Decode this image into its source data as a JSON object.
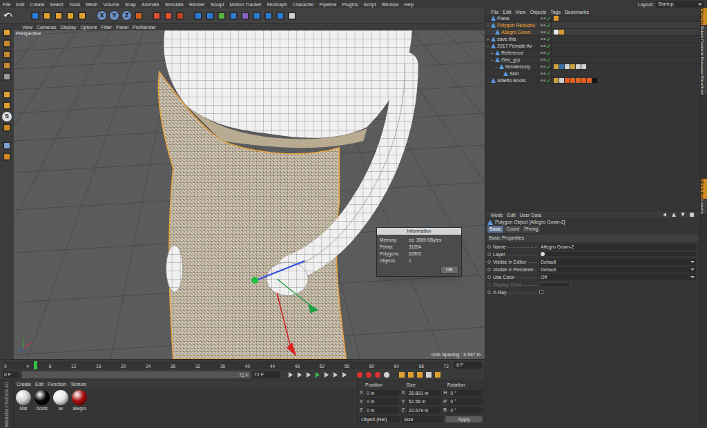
{
  "menu_bar": {
    "items": [
      "File",
      "Edit",
      "Create",
      "Select",
      "Tools",
      "Mesh",
      "Volume",
      "Snap",
      "Animate",
      "Simulate",
      "Render",
      "Sculpt",
      "Motion Tracker",
      "MoGraph",
      "Character",
      "Pipeline",
      "Plugins",
      "Script",
      "Window",
      "Help"
    ],
    "layout_label": "Layout:",
    "layout_value": "Startup"
  },
  "toolbar": {
    "axis_buttons": [
      {
        "label": "X",
        "on": true
      },
      {
        "label": "Y",
        "on": true
      },
      {
        "label": "Z",
        "on": true
      }
    ]
  },
  "left_tools": {
    "snap_label": "S"
  },
  "viewport": {
    "menu": [
      "View",
      "Cameras",
      "Display",
      "Options",
      "Filter",
      "Panel",
      "ProRender"
    ],
    "camera": "Perspective",
    "grid_spacing": "Grid Spacing : 3.937 in"
  },
  "info_dialog": {
    "title": "Information",
    "rows": [
      {
        "label": "Memory:",
        "value": "ca. 3889 KBytes"
      },
      {
        "label": "Points:",
        "value": "31654"
      },
      {
        "label": "Polygons:",
        "value": "62892"
      },
      {
        "label": "Objects:",
        "value": "1"
      }
    ],
    "button": "OK"
  },
  "timeline": {
    "ticks": [
      "0",
      "4",
      "8",
      "12",
      "16",
      "20",
      "24",
      "28",
      "32",
      "36",
      "40",
      "44",
      "48",
      "52",
      "56",
      "60",
      "64",
      "68",
      "72"
    ],
    "level": 0.07,
    "frame_field": "6 F"
  },
  "transport": {
    "start": "0 F",
    "range_end": "72 F",
    "end": "72 F"
  },
  "materials": {
    "menu": [
      "Create",
      "Edit",
      "Function",
      "Texture"
    ],
    "items": [
      {
        "name": "Mat",
        "color": "#cfcfcf"
      },
      {
        "name": "boots",
        "color": "#050505"
      },
      {
        "name": "av",
        "color": "#e6e6e6"
      },
      {
        "name": "allegro",
        "color": "#a80d0d"
      }
    ]
  },
  "coordinates": {
    "headers": [
      "Position",
      "Size",
      "Rotation"
    ],
    "rows": [
      {
        "p_axis": "X",
        "p": "0 in",
        "s_axis": "X",
        "s": "28.891 in",
        "r_axis": "H",
        "r": "0 °"
      },
      {
        "p_axis": "Y",
        "p": "0 in",
        "s_axis": "Y",
        "s": "52.56 in",
        "r_axis": "P",
        "r": "0 °"
      },
      {
        "p_axis": "Z",
        "p": "0 in",
        "s_axis": "Z",
        "s": "22.679 in",
        "r_axis": "B",
        "r": "0 °"
      }
    ],
    "mode": "Object (Rel)",
    "size_mode": "Size",
    "apply": "Apply"
  },
  "object_manager": {
    "menu": [
      "File",
      "Edit",
      "View",
      "Objects",
      "Tags",
      "Bookmarks"
    ],
    "objects": [
      {
        "name": "Plane",
        "depth": 0,
        "expandable": false,
        "expanded": false,
        "selected": false,
        "enabled": true,
        "tags": [
          "#d99a2b"
        ]
      },
      {
        "name": "Polygon Reductio",
        "depth": 0,
        "expandable": true,
        "expanded": true,
        "selected": true,
        "enabled": true,
        "tags": []
      },
      {
        "name": "Allegro Gown",
        "depth": 1,
        "expandable": false,
        "expanded": false,
        "selected": true,
        "enabled": true,
        "tags": [
          "#e6e6e6",
          "#d99a2b"
        ]
      },
      {
        "name": "save this",
        "depth": 0,
        "expandable": true,
        "expanded": false,
        "selected": false,
        "enabled": true,
        "tags": []
      },
      {
        "name": "2017 Female Av",
        "depth": 0,
        "expandable": true,
        "expanded": true,
        "selected": false,
        "enabled": true,
        "tags": []
      },
      {
        "name": "Reference",
        "depth": 1,
        "expandable": true,
        "expanded": false,
        "selected": false,
        "enabled": true,
        "tags": []
      },
      {
        "name": "Geo_grp",
        "depth": 1,
        "expandable": true,
        "expanded": true,
        "selected": false,
        "enabled": true,
        "tags": []
      },
      {
        "name": "femalebody",
        "depth": 2,
        "expandable": true,
        "expanded": true,
        "selected": false,
        "enabled": true,
        "tags": [
          "#c9a040",
          "#3a6ea5",
          "#d0d0d0",
          "#c9a040",
          "#d0d0d0",
          "#d0d0d0"
        ]
      },
      {
        "name": "Skin",
        "depth": 3,
        "expandable": false,
        "expanded": false,
        "selected": false,
        "enabled": true,
        "tags": []
      },
      {
        "name": "Stiletto Boots",
        "depth": 0,
        "expandable": false,
        "expanded": false,
        "selected": false,
        "enabled": true,
        "tags": [
          "#c9a040",
          "#d0d0d0",
          "#e06020",
          "#e06020",
          "#e06020",
          "#e06020",
          "#e06020",
          "#111111"
        ]
      }
    ]
  },
  "attributes": {
    "menu": [
      "Mode",
      "Edit",
      "User Data"
    ],
    "object_title": "Polygon Object [Allegro Gown-2]",
    "tabs": [
      {
        "label": "Basic",
        "selected": true
      },
      {
        "label": "Coord",
        "selected": false
      },
      {
        "label": "Phong",
        "selected": false
      }
    ],
    "section": "Basic Properties",
    "fields": [
      {
        "kind": "text",
        "label": "Name",
        "value": "Allegro Gown-2",
        "disabled": false,
        "checked": false
      },
      {
        "kind": "layer",
        "label": "Layer",
        "value": "",
        "disabled": false,
        "checked": false
      },
      {
        "kind": "select",
        "label": "Visible in Editor",
        "value": "Default",
        "disabled": false,
        "checked": false
      },
      {
        "kind": "select",
        "label": "Visible in Renderer",
        "value": "Default",
        "disabled": false,
        "checked": false
      },
      {
        "kind": "select",
        "label": "Use Color",
        "value": "Off",
        "disabled": false,
        "checked": false
      },
      {
        "kind": "color",
        "label": "Display Color",
        "value": "",
        "disabled": true,
        "checked": false
      },
      {
        "kind": "checkbox",
        "label": "X-Ray",
        "value": "",
        "disabled": false,
        "checked": false
      }
    ]
  },
  "side_tabs_top": [
    {
      "label": "Objects",
      "selected": true
    },
    {
      "label": "Takes",
      "selected": false
    },
    {
      "label": "Content Browser",
      "selected": false
    },
    {
      "label": "Structure",
      "selected": false
    }
  ],
  "side_tabs_bottom": [
    {
      "label": "Attributes",
      "selected": true
    },
    {
      "label": "Layers",
      "selected": false
    }
  ],
  "logo": {
    "brand": "MAXON",
    "product": "CINEMA 4D"
  }
}
